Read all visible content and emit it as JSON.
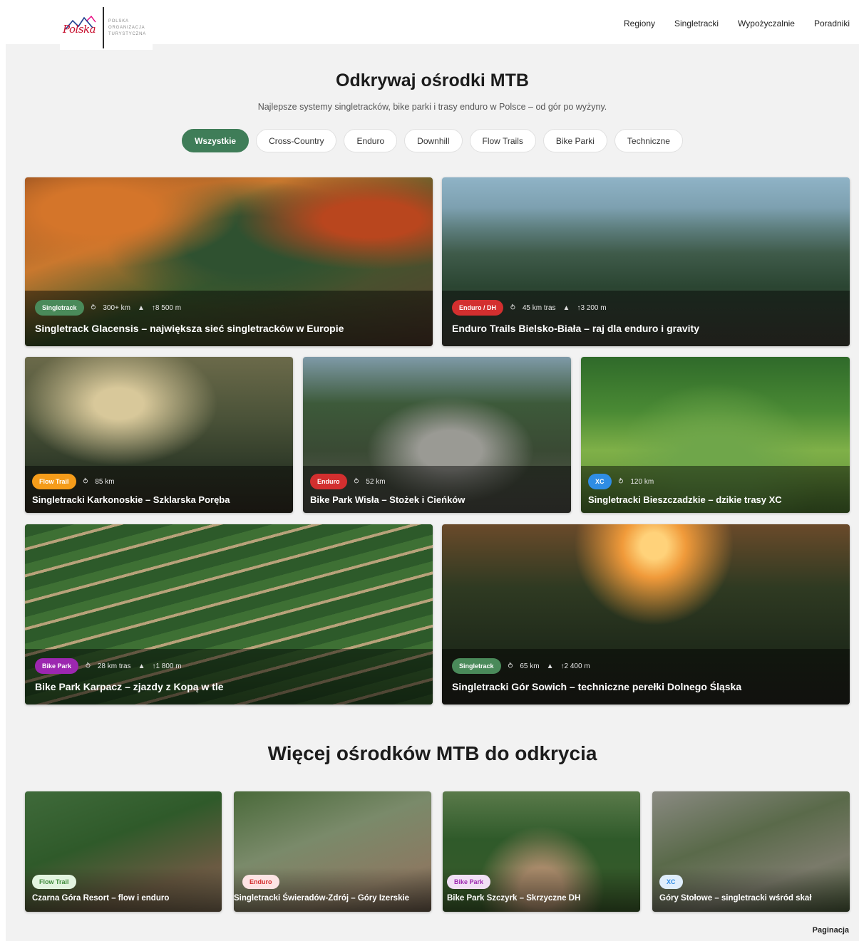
{
  "colors": {
    "accent": "#3f7d58",
    "singletrack": "#4a8a5a",
    "enduro": "#d32f2f",
    "flow": "#f59c1a",
    "xc": "#2f8de4",
    "bikepark": "#9c27b0"
  },
  "header": {
    "logo_word": "Polska",
    "logo_text": [
      "POLSKA",
      "ORGANIZACJA",
      "TURYSTYCZNA"
    ],
    "nav": [
      "Regiony",
      "Singletracki",
      "Wypożyczalnie",
      "Poradniki"
    ]
  },
  "hero": {
    "title": "Odkrywaj ośrodki MTB",
    "subtitle": "Najlepsze systemy singletracków, bike parki i trasy enduro w Polsce – od gór po wyżyny."
  },
  "filters": [
    "Wszystkie",
    "Cross-Country",
    "Enduro",
    "Downhill",
    "Flow Trails",
    "Bike Parki",
    "Techniczne"
  ],
  "featured": [
    {
      "badge": "Singletrack",
      "km": "300+ km",
      "elev": "↑8 500 m",
      "title": "Singletrack Glacensis – największa sieć singletracków w Europie"
    },
    {
      "badge": "Enduro / DH",
      "km": "45 km tras",
      "elev": "↑3 200 m",
      "title": "Enduro Trails Bielsko-Biała – raj dla enduro i gravity"
    },
    {
      "badge": "Flow Trail",
      "km": "85 km",
      "title": "Singletracki Karkonoskie – Szklarska Poręba"
    },
    {
      "badge": "Enduro",
      "km": "52 km",
      "title": "Bike Park Wisła – Stożek i Cieńków"
    },
    {
      "badge": "XC",
      "km": "120 km",
      "title": "Singletracki Bieszczadzkie – dzikie trasy XC"
    },
    {
      "badge": "Bike Park",
      "km": "28 km tras",
      "elev": "↑1 800 m",
      "title": "Bike Park Karpacz – zjazdy z Kopą w tle"
    },
    {
      "badge": "Singletrack",
      "km": "65 km",
      "elev": "↑2 400 m",
      "title": "Singletracki Gór Sowich – techniczne perełki Dolnego Śląska"
    }
  ],
  "more": {
    "title": "Więcej ośrodków MTB do odkrycia",
    "items": [
      {
        "badge": "Flow Trail",
        "title": "Czarna Góra Resort – flow i enduro"
      },
      {
        "badge": "Enduro",
        "title": "Singletracki Świeradów-Zdrój – Góry Izerskie"
      },
      {
        "badge": "Bike Park",
        "title": "Bike Park Szczyrk – Skrzyczne DH"
      },
      {
        "badge": "XC",
        "title": "Góry Stołowe – singletracki wśród skał"
      }
    ]
  },
  "pagination": "Paginacja"
}
